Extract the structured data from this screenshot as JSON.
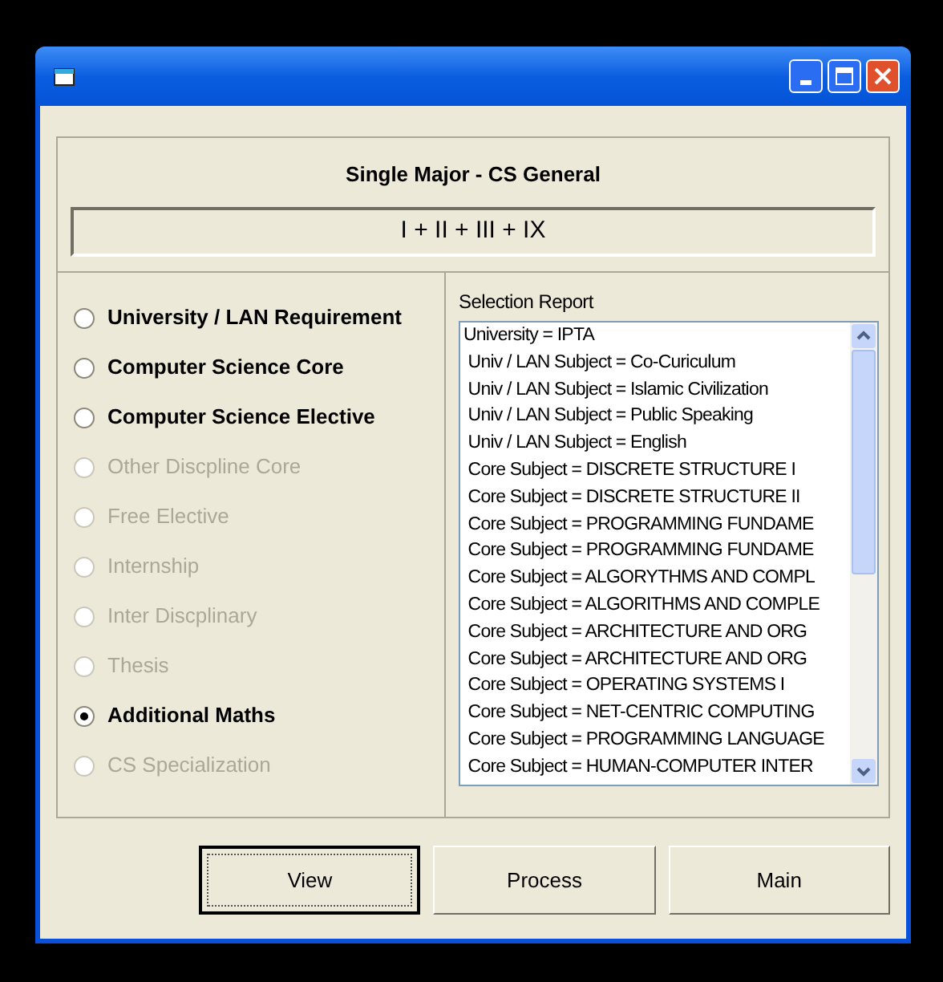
{
  "header": {
    "title": "Single Major - CS General",
    "formula": "I + II + III + IX"
  },
  "options": [
    {
      "label": "University / LAN Requirement",
      "selected": false,
      "disabled": false
    },
    {
      "label": "Computer Science Core",
      "selected": false,
      "disabled": false
    },
    {
      "label": "Computer Science Elective",
      "selected": false,
      "disabled": false
    },
    {
      "label": "Other Discpline Core",
      "selected": false,
      "disabled": true
    },
    {
      "label": "Free Elective",
      "selected": false,
      "disabled": true
    },
    {
      "label": "Internship",
      "selected": false,
      "disabled": true
    },
    {
      "label": "Inter Discplinary",
      "selected": false,
      "disabled": true
    },
    {
      "label": "Thesis",
      "selected": false,
      "disabled": true
    },
    {
      "label": "Additional Maths",
      "selected": true,
      "disabled": false
    },
    {
      "label": "CS Specialization",
      "selected": false,
      "disabled": true
    }
  ],
  "report": {
    "label": "Selection Report",
    "lines": [
      "University = IPTA",
      " Univ / LAN Subject = Co-Curiculum",
      " Univ / LAN Subject = Islamic Civilization",
      " Univ / LAN Subject = Public Speaking",
      " Univ / LAN Subject = English",
      " Core Subject = DISCRETE STRUCTURE I",
      " Core Subject = DISCRETE STRUCTURE II",
      " Core Subject = PROGRAMMING FUNDAME",
      " Core Subject = PROGRAMMING FUNDAME",
      " Core Subject = ALGORYTHMS AND COMPL",
      " Core Subject = ALGORITHMS AND COMPLE",
      " Core Subject = ARCHITECTURE AND ORG",
      " Core Subject = ARCHITECTURE AND ORG",
      " Core Subject = OPERATING SYSTEMS I",
      " Core Subject = NET-CENTRIC COMPUTING",
      " Core Subject = PROGRAMMING LANGUAGE",
      " Core Subject = HUMAN-COMPUTER INTER"
    ]
  },
  "buttons": [
    {
      "label": "View",
      "focused": true
    },
    {
      "label": "Process",
      "focused": false
    },
    {
      "label": "Main",
      "focused": false
    }
  ]
}
